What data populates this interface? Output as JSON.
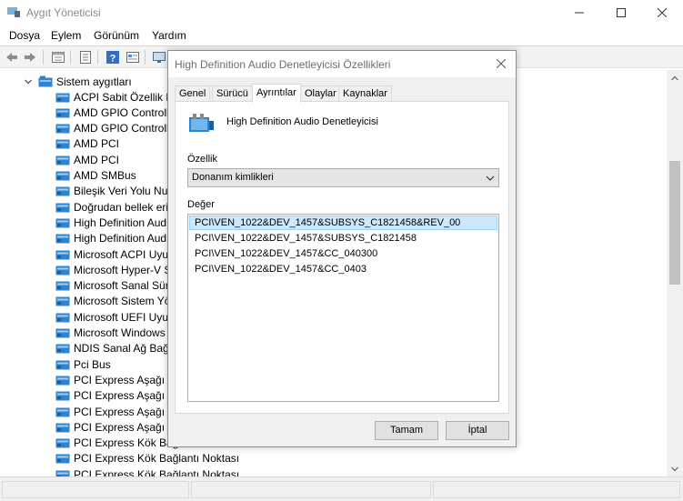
{
  "window": {
    "title": "Aygıt Yöneticisi",
    "controls": [
      "minimize",
      "maximize",
      "close"
    ]
  },
  "menu": [
    "Dosya",
    "Eylem",
    "Görünüm",
    "Yardım"
  ],
  "toolbar_icons": [
    "back-arrow-icon",
    "forward-arrow-icon",
    "properties-icon",
    "list-icon",
    "help-icon",
    "details-icon",
    "monitor-icon"
  ],
  "tree": {
    "root_label": "Sistem aygıtları",
    "items": [
      "ACPI Sabit Özellik Di",
      "AMD GPIO Controlle",
      "AMD GPIO Controlle",
      "AMD PCI",
      "AMD PCI",
      "AMD SMBus",
      "Bileşik Veri Yolu Nun",
      "Doğrudan bellek eriş",
      "High Definition Aud",
      "High Definition Aud",
      "Microsoft ACPI Uyun",
      "Microsoft Hyper-V S",
      "Microsoft Sanal Sürü",
      "Microsoft Sistem Yö",
      "Microsoft UEFI Uyun",
      "Microsoft Windows",
      "NDIS Sanal Ağ Bağda",
      "Pci Bus",
      "PCI Express Aşağı Ak",
      "PCI Express Aşağı Ak",
      "PCI Express Aşağı Ak",
      "PCI Express Aşağı Ak",
      "PCI Express Kök Bağl",
      "PCI Express Kök Bağlantı Noktası",
      "PCI Express Kök Bağlantı Noktası"
    ]
  },
  "dialog": {
    "title": "High Definition Audio Denetleyicisi Özellikleri",
    "tabs": [
      "Genel",
      "Sürücü",
      "Ayrıntılar",
      "Olaylar",
      "Kaynaklar"
    ],
    "active_tab": "Ayrıntılar",
    "device_name": "High Definition Audio Denetleyicisi",
    "property_label": "Özellik",
    "property_value": "Donanım kimlikleri",
    "value_label": "Değer",
    "values": [
      "PCI\\VEN_1022&DEV_1457&SUBSYS_C1821458&REV_00",
      "PCI\\VEN_1022&DEV_1457&SUBSYS_C1821458",
      "PCI\\VEN_1022&DEV_1457&CC_040300",
      "PCI\\VEN_1022&DEV_1457&CC_0403"
    ],
    "selected_value_index": 0,
    "ok_label": "Tamam",
    "cancel_label": "İptal"
  },
  "colors": {
    "selection": "#cce8ff",
    "selection_border": "#99d1ff",
    "dialog_bg": "#f0f0f0",
    "device_icon": "#1e7fd0"
  }
}
